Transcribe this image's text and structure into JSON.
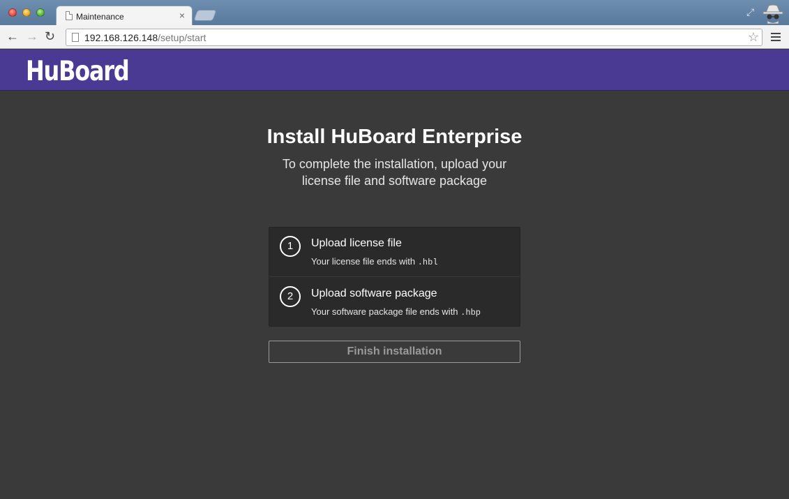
{
  "browser": {
    "tab": {
      "title": "Maintenance",
      "close": "×"
    },
    "address": {
      "host": "192.168.126.148",
      "path": "/setup/start"
    },
    "icons": {
      "back": "arrow-left-icon",
      "forward": "arrow-right-icon",
      "reload": "reload-icon",
      "bookmark": "star-icon",
      "menu": "hamburger-menu-icon",
      "incognito": "incognito-icon",
      "fullscreen": "expand-icon"
    }
  },
  "app": {
    "logo": "HuBoard",
    "brand_color": "#4b3a94"
  },
  "main": {
    "title": "Install HuBoard Enterprise",
    "subtitle": "To complete the installation, upload your license file and software package",
    "steps": [
      {
        "number": "1",
        "title": "Upload license file",
        "desc": "Your license file ends with",
        "ext": ".hbl"
      },
      {
        "number": "2",
        "title": "Upload software package",
        "desc": "Your software package file ends with",
        "ext": ".hbp"
      }
    ],
    "finish_label": "Finish installation"
  }
}
